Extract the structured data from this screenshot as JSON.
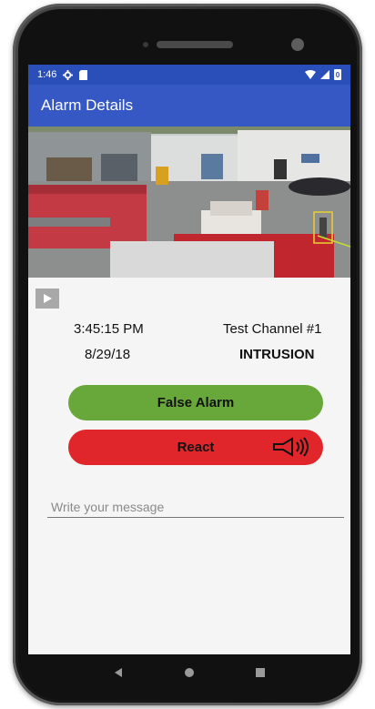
{
  "status_bar": {
    "time": "1:46",
    "battery": "0"
  },
  "app_bar": {
    "title": "Alarm Details"
  },
  "alarm": {
    "time": "3:45:15 PM",
    "date": "8/29/18",
    "channel": "Test Channel #1",
    "type": "INTRUSION"
  },
  "actions": {
    "false_alarm_label": "False Alarm",
    "react_label": "React"
  },
  "message": {
    "placeholder": "Write your message",
    "value": ""
  },
  "colors": {
    "status_bar": "#2a4fb8",
    "app_bar": "#3558c4",
    "false_alarm": "#68a83a",
    "react": "#e0262a"
  },
  "icons": {
    "status": [
      "gear-icon",
      "sd-card-icon",
      "wifi-icon",
      "signal-icon",
      "battery-icon"
    ],
    "navigation": [
      "back-icon",
      "home-icon",
      "recents-icon"
    ],
    "other": [
      "play-icon",
      "megaphone-icon"
    ]
  }
}
